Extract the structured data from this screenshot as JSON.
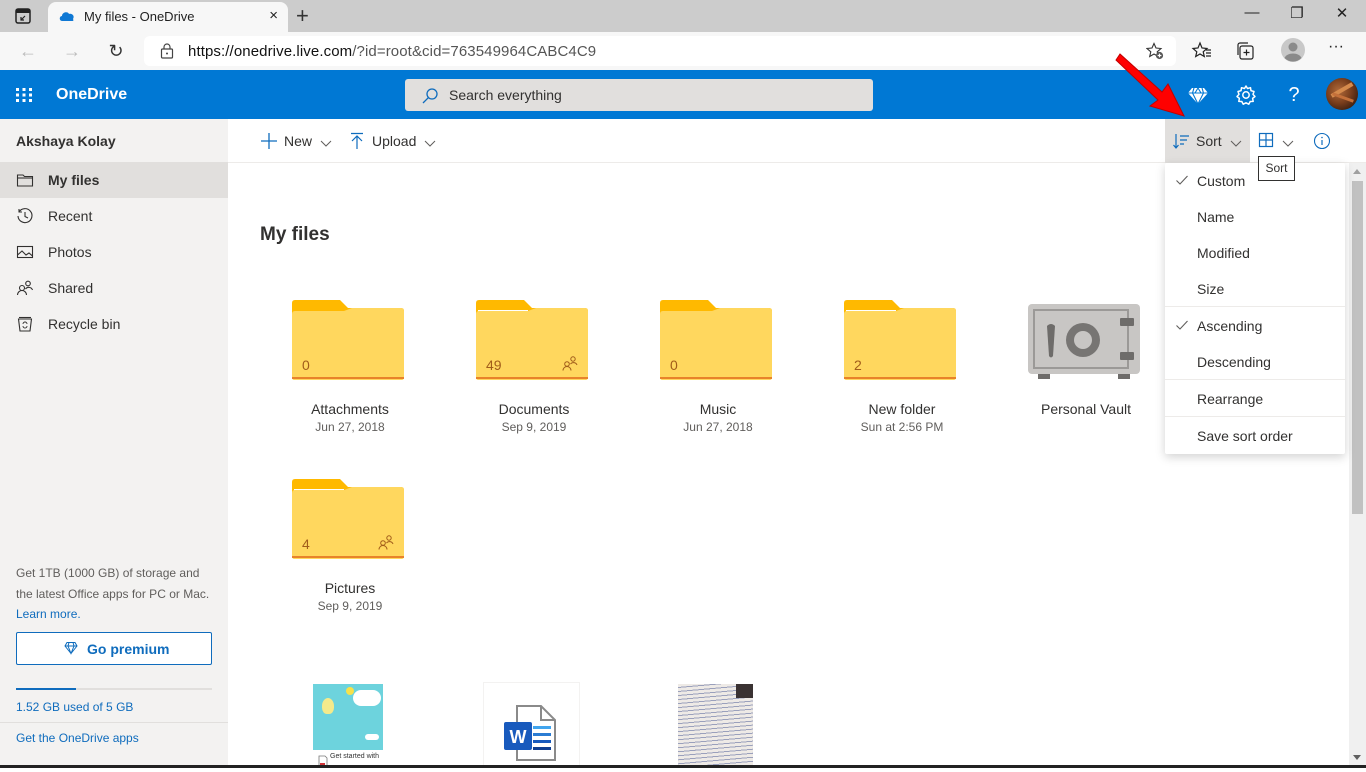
{
  "browser": {
    "tab_title": "My files - OneDrive",
    "tab_close": "×",
    "new_tab": "+",
    "url_domain": "https://onedrive.live.com",
    "url_rest": "/?id=root&cid=763549964CABC4C9",
    "window_controls": {
      "minimize": "—",
      "restore": "❐",
      "close": "✕"
    },
    "nav": {
      "back": "←",
      "forward": "→",
      "reload": "↻"
    },
    "toolbar_more": "···"
  },
  "header": {
    "app_name": "OneDrive",
    "search_placeholder": "Search everything",
    "icons": [
      "app-launcher-icon",
      "premium-diamond-icon",
      "settings-gear-icon",
      "help-icon",
      "account-avatar"
    ]
  },
  "sidebar": {
    "user_name": "Akshaya Kolay",
    "items": [
      {
        "label": "My files",
        "icon": "folder-icon",
        "active": true
      },
      {
        "label": "Recent",
        "icon": "history-icon",
        "active": false
      },
      {
        "label": "Photos",
        "icon": "photo-icon",
        "active": false
      },
      {
        "label": "Shared",
        "icon": "people-icon",
        "active": false
      },
      {
        "label": "Recycle bin",
        "icon": "recycle-bin-icon",
        "active": false
      }
    ],
    "promo_text": "Get 1TB (1000 GB) of storage and the latest Office apps for PC or Mac.",
    "learn_more": "Learn more.",
    "go_premium": "Go premium",
    "storage": {
      "used_gb": 1.52,
      "total_gb": 5,
      "text": "1.52 GB used of 5 GB"
    },
    "get_apps": "Get the OneDrive apps"
  },
  "commandbar": {
    "new_label": "New",
    "upload_label": "Upload",
    "sort_label": "Sort",
    "view_icon": "tiles-view-icon",
    "info_icon": "info-icon",
    "tooltip": "Sort"
  },
  "sort_menu": {
    "items": [
      {
        "label": "Custom",
        "checked": true
      },
      {
        "label": "Name",
        "checked": false
      },
      {
        "label": "Modified",
        "checked": false
      },
      {
        "label": "Size",
        "checked": false
      },
      {
        "label": "Ascending",
        "checked": true
      },
      {
        "label": "Descending",
        "checked": false
      },
      {
        "label": "Rearrange",
        "checked": false
      },
      {
        "label": "Save sort order",
        "checked": false
      }
    ]
  },
  "main": {
    "title": "My files",
    "folders": [
      {
        "name": "Attachments",
        "date": "Jun 27, 2018",
        "count": "0",
        "shared": false,
        "has_content": false
      },
      {
        "name": "Documents",
        "date": "Sep 9, 2019",
        "count": "49",
        "shared": true,
        "has_content": true
      },
      {
        "name": "Music",
        "date": "Jun 27, 2018",
        "count": "0",
        "shared": false,
        "has_content": false
      },
      {
        "name": "New folder",
        "date": "Sun at 2:56 PM",
        "count": "2",
        "shared": false,
        "has_content": true
      },
      {
        "name": "Personal Vault",
        "date": "",
        "type": "vault"
      },
      {
        "name": "Pictures",
        "date": "Sep 9, 2019",
        "count": "4",
        "shared": true,
        "has_content": true
      }
    ],
    "files": [
      {
        "type": "pdf-thumbnail",
        "caption": "Get started with"
      },
      {
        "type": "word-document"
      },
      {
        "type": "image-thumbnail"
      }
    ]
  },
  "colors": {
    "brand_blue": "#0078d4",
    "link_blue": "#0f6cbd",
    "folder_yellow": "#ffd75e",
    "folder_tab": "#ffb900",
    "annotation_red": "#ff0000"
  }
}
